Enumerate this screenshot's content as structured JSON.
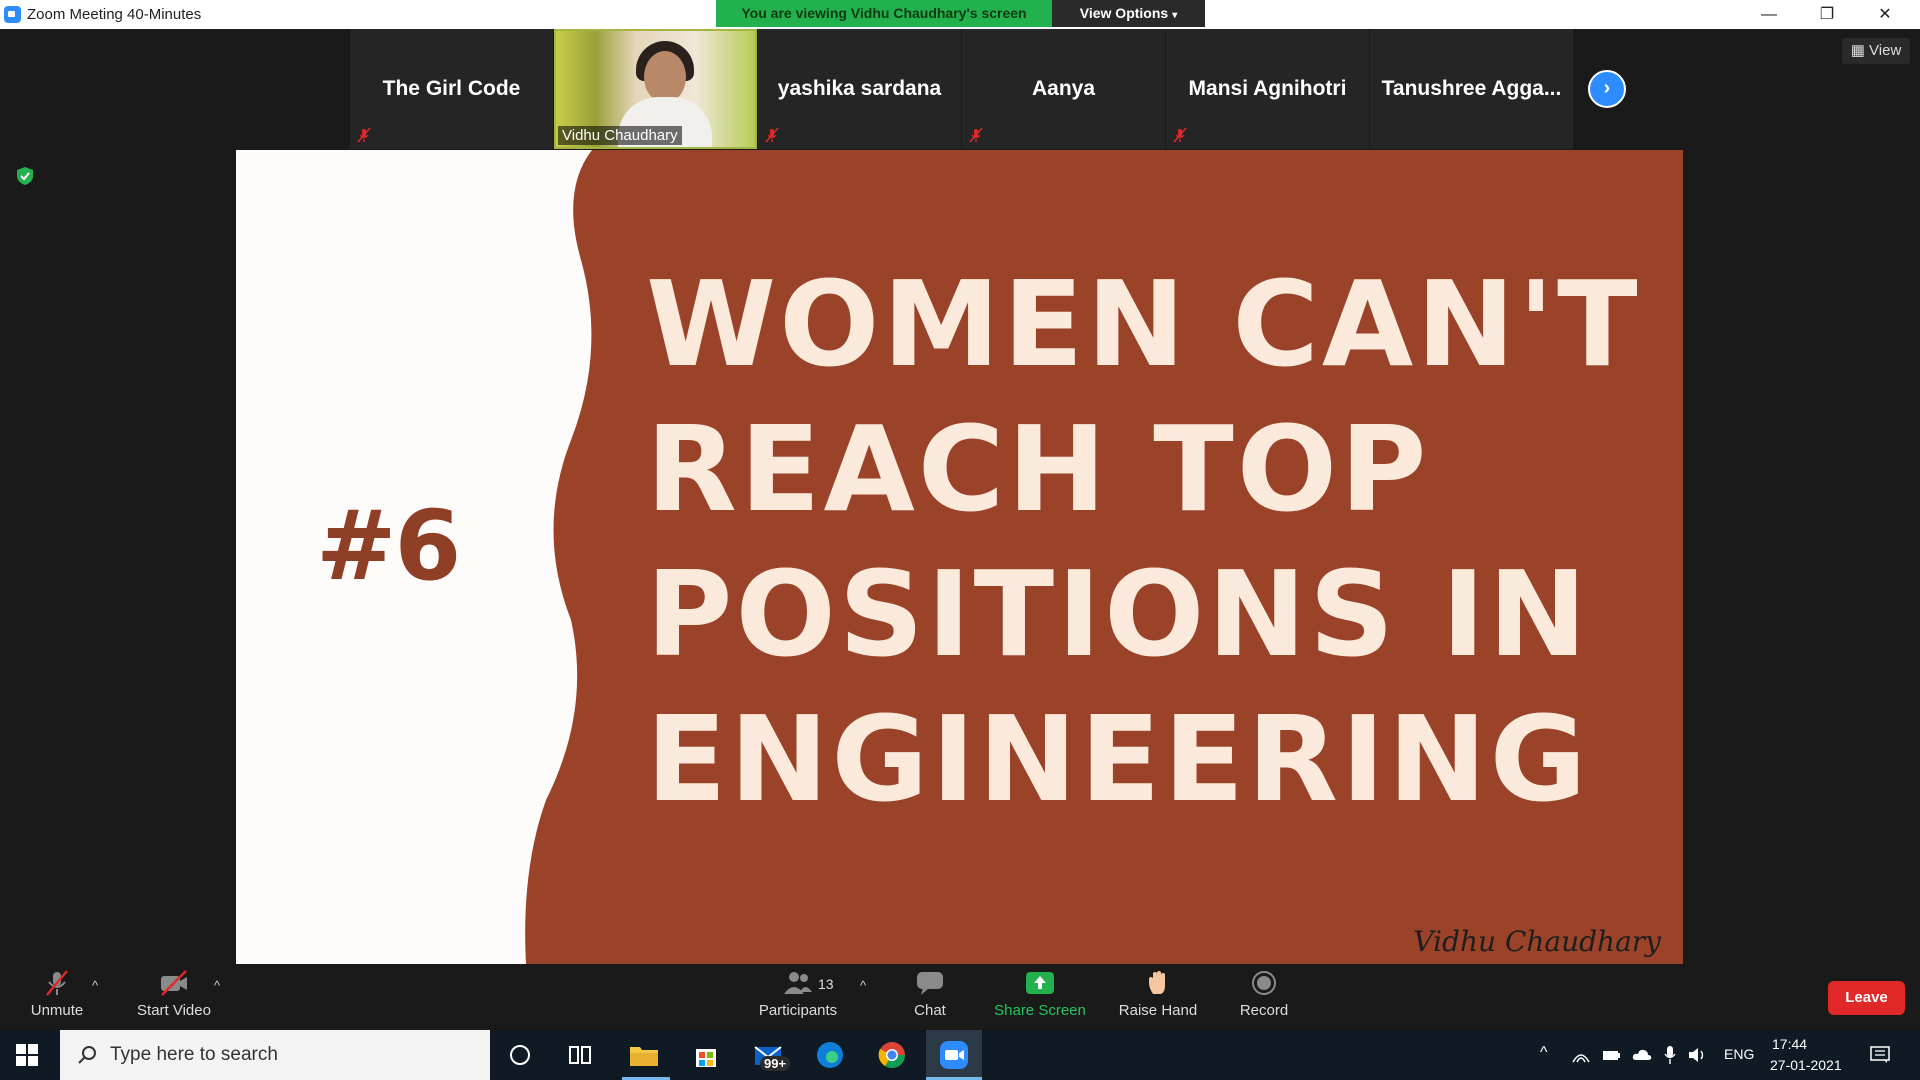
{
  "window": {
    "title": "Zoom Meeting 40-Minutes",
    "viewing_banner": "You are viewing Vidhu Chaudhary's screen",
    "view_options": "View Options"
  },
  "gallery": {
    "tiles": [
      {
        "name": "The Girl Code"
      },
      {
        "name": "Vidhu Chaudhary"
      },
      {
        "name": "yashika sardana"
      },
      {
        "name": "Aanya"
      },
      {
        "name": "Mansi Agnihotri"
      },
      {
        "name": "Tanushree  Agga..."
      }
    ],
    "view_label": "View"
  },
  "slide": {
    "number": "#6",
    "lines": [
      "WOMEN CAN'T",
      "REACH TOP",
      "POSITIONS IN",
      "ENGINEERING"
    ],
    "signature": "Vidhu Chaudhary",
    "colors": {
      "rust": "#9a4329",
      "cream": "#fbe9dc",
      "white": "#fdfcfb"
    }
  },
  "controls": {
    "unmute": "Unmute",
    "start_video": "Start Video",
    "participants": "Participants",
    "participants_count": "13",
    "chat": "Chat",
    "share_screen": "Share Screen",
    "raise_hand": "Raise Hand",
    "record": "Record",
    "leave": "Leave"
  },
  "taskbar": {
    "search_placeholder": "Type here to search",
    "mail_badge": "99+",
    "language": "ENG",
    "time": "17:44",
    "date": "27-01-2021"
  }
}
